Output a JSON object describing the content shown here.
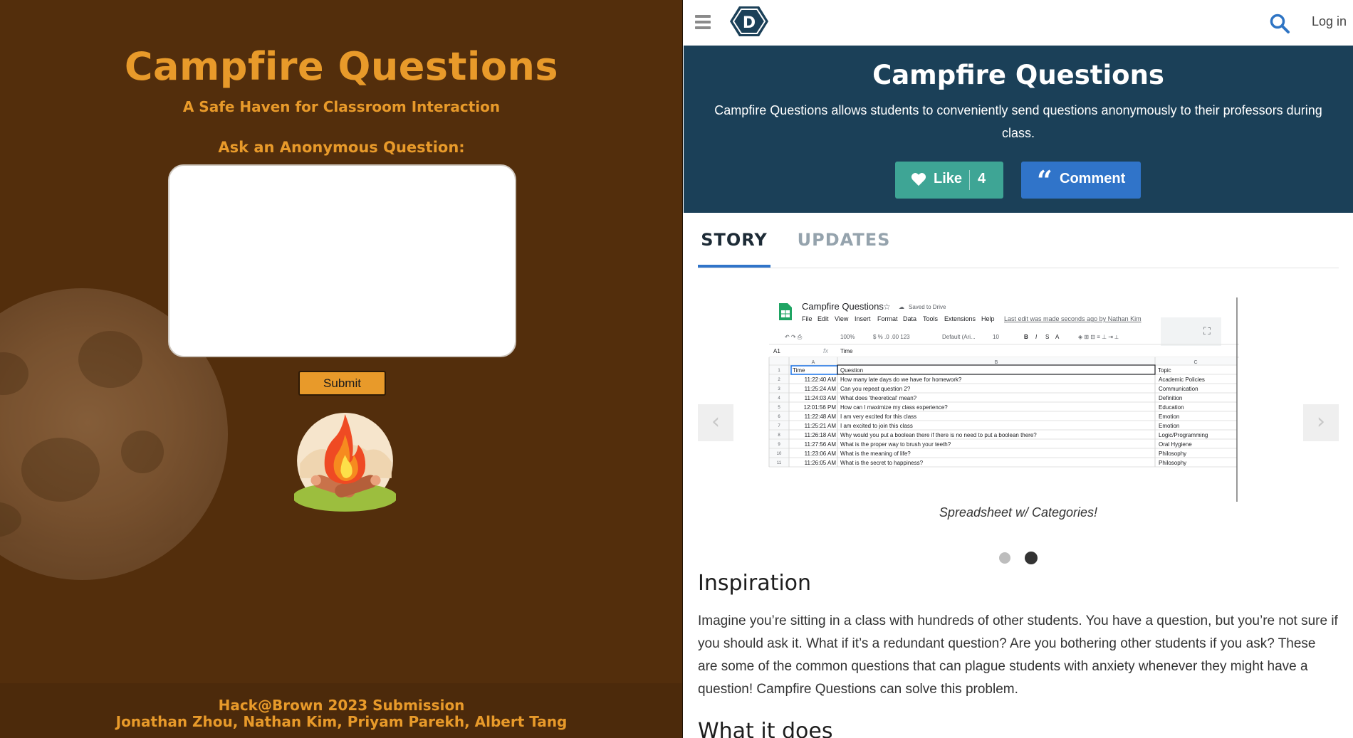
{
  "left": {
    "title": "Campfire Questions",
    "tagline": "A Safe Haven for Classroom Interaction",
    "ask_label": "Ask an Anonymous Question:",
    "question_value": "",
    "submit_label": "Submit",
    "footer_line1": "Hack@Brown 2023 Submission",
    "footer_line2": "Jonathan Zhou, Nathan Kim, Priyam Parekh, Albert Tang",
    "colors": {
      "background": "#532e0c",
      "accent": "#e89a2a"
    }
  },
  "right": {
    "logo_letter": "D",
    "login_label": "Log in",
    "banner": {
      "title": "Campfire Questions",
      "description": "Campfire Questions allows students to conveniently send questions anonymously to their professors during class.",
      "like_label": "Like",
      "like_count": "4",
      "comment_label": "Comment"
    },
    "tabs": [
      {
        "label": "STORY",
        "active": true
      },
      {
        "label": "UPDATES",
        "active": false
      }
    ],
    "carousel": {
      "caption": "Spreadsheet w/ Categories!",
      "active_slide": 2,
      "slide_count": 2
    },
    "spreadsheet": {
      "doc_title": "Campfire Questions",
      "saved_status": "Saved to Drive",
      "menu": [
        "File",
        "Edit",
        "View",
        "Insert",
        "Format",
        "Data",
        "Tools",
        "Extensions",
        "Help"
      ],
      "last_edit": "Last edit was made seconds ago by Nathan Kim",
      "zoom": "100%",
      "font": "Default (Ari...",
      "font_size": "10",
      "cell_ref": "A1",
      "formula_value": "Time",
      "col_letters": [
        "A",
        "B",
        "C"
      ],
      "headers": [
        "Time",
        "Question",
        "Topic"
      ],
      "rows": [
        [
          "11:22:40 AM",
          "How many late days do we have for homework?",
          "Academic Policies"
        ],
        [
          "11:25:24 AM",
          "Can you repeat question 2?",
          "Communication"
        ],
        [
          "11:24:03 AM",
          "What does 'theoretical' mean?",
          "Definition"
        ],
        [
          "12:01:56 PM",
          "How can I maximize my class experience?",
          "Education"
        ],
        [
          "11:22:48 AM",
          "I am very excited for this class",
          "Emotion"
        ],
        [
          "11:25:21 AM",
          "I am excited to join this class",
          "Emotion"
        ],
        [
          "11:26:18 AM",
          "Why would you put a boolean there if there is no need to put a boolean there?",
          "Logic/Programming"
        ],
        [
          "11:27:56 AM",
          "What is the proper way to brush your teeth?",
          "Oral Hygiene"
        ],
        [
          "11:23:06 AM",
          "What is the meaning of life?",
          "Philosophy"
        ],
        [
          "11:26:05 AM",
          "What is the secret to happiness?",
          "Philosophy"
        ]
      ]
    },
    "inspiration": {
      "heading": "Inspiration",
      "text": "Imagine you’re sitting in a class with hundreds of other students. You have a question, but you’re not sure if you should ask it. What if it’s a redundant question? Are you bothering other students if you ask? These are some of the common questions that can plague students with anxiety whenever they might have a question! Campfire Questions can solve this problem."
    },
    "what_it_does_heading": "What it does",
    "colors": {
      "banner": "#1b4058",
      "like": "#3ea595",
      "comment": "#3074c9",
      "tab_active": "#3074c9"
    }
  }
}
